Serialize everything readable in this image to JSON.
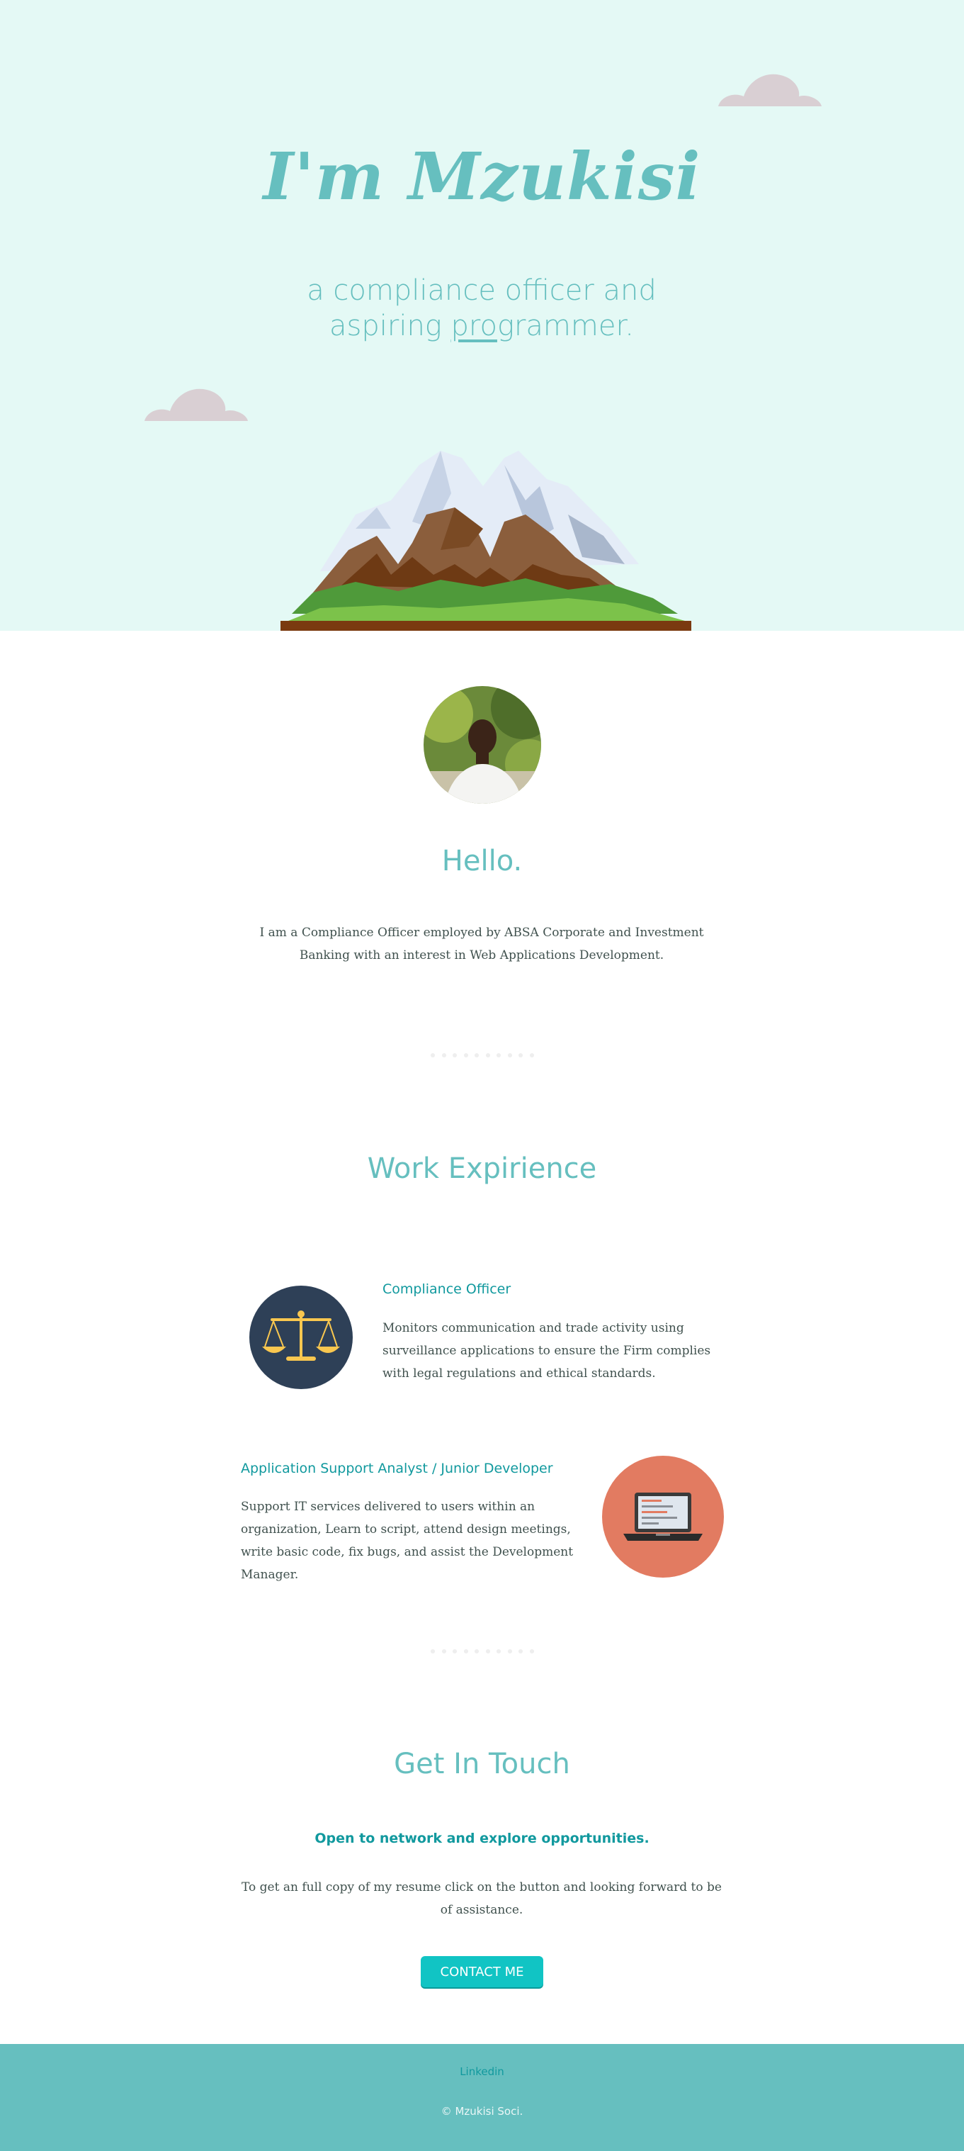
{
  "hero": {
    "title": "I'm Mzukisi",
    "subtitle_line1": "a compliance officer and",
    "subtitle_line2_pre": "aspiring ",
    "subtitle_line2_underlined": "pro",
    "subtitle_line2_post": "grammer."
  },
  "about": {
    "heading": "Hello.",
    "text": "I am a Compliance Officer employed by ABSA Corporate and Investment Banking with an interest in Web Applications Development."
  },
  "work": {
    "heading": "Work Expirience",
    "jobs": [
      {
        "title": "Compliance Officer",
        "description": "Monitors communication and trade activity using surveillance applications to ensure the Firm complies with legal regulations and ethical standards.",
        "icon": "scales-icon"
      },
      {
        "title": "Application Support Analyst / Junior Developer",
        "description": "Support IT services delivered to users within an organization, Learn to script, attend design meetings, write basic code, fix bugs, and assist the Development Manager.",
        "icon": "laptop-icon"
      }
    ]
  },
  "contact": {
    "heading": "Get In Touch",
    "subheading": "Open to network and explore opportunities.",
    "text": "To get an full copy of my resume click on the button and looking forward to be of assistance.",
    "button_label": "CONTACT ME"
  },
  "footer": {
    "link_label": "Linkedin",
    "copyright": "© Mzukisi Soci."
  },
  "colors": {
    "hero_bg": "#e4f9f5",
    "accent": "#66bfbf",
    "accent_dark": "#11999e",
    "button": "#11c4c4",
    "job1_circle": "#2e4057",
    "job2_circle": "#e27b61"
  }
}
